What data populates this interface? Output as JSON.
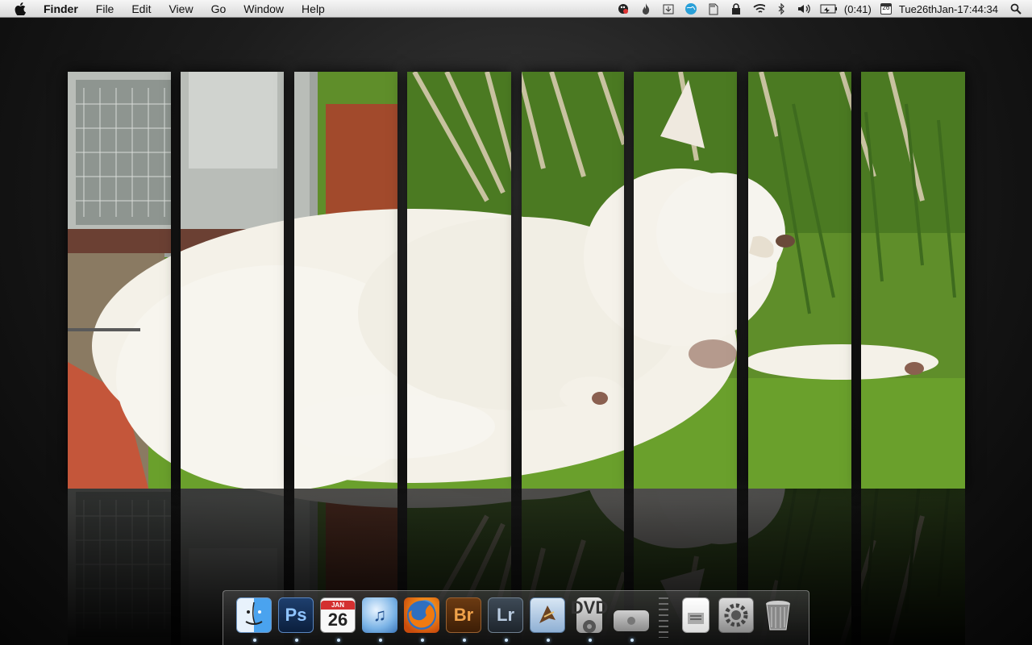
{
  "menubar": {
    "apple_icon": "apple-icon",
    "app_name": "Finder",
    "menus": [
      "File",
      "Edit",
      "View",
      "Go",
      "Window",
      "Help"
    ],
    "status_icons": [
      "growl-icon",
      "flame-icon",
      "download-icon",
      "globe-icon",
      "sd-card-icon",
      "lock-icon",
      "wifi-icon",
      "bluetooth-icon",
      "volume-icon",
      "battery-icon"
    ],
    "battery_text": "(0:41)",
    "calendar_day": "26",
    "clock": "Tue26thJan-17:44:34",
    "spotlight_icon": "spotlight-icon"
  },
  "desktop": {
    "wallpaper": "white dog lying on grass, split into vertical strips with reflection",
    "colors": {
      "grass": "#6a9a2a",
      "fur": "#f4f2ea",
      "background_dark": "#111111",
      "shed_red": "#b84a30"
    }
  },
  "dock": {
    "items": [
      {
        "name": "Finder",
        "icon": "finder-icon",
        "label": "",
        "running": true
      },
      {
        "name": "Photoshop",
        "icon": "photoshop-icon",
        "label": "Ps",
        "running": true
      },
      {
        "name": "iCal",
        "icon": "calendar-icon",
        "label": "26",
        "month": "JAN",
        "running": true
      },
      {
        "name": "iTunes",
        "icon": "itunes-icon",
        "label": "♫",
        "running": true
      },
      {
        "name": "Firefox",
        "icon": "firefox-icon",
        "label": "",
        "running": true
      },
      {
        "name": "Bridge",
        "icon": "bridge-icon",
        "label": "Br",
        "running": true
      },
      {
        "name": "Lightroom",
        "icon": "lightroom-icon",
        "label": "Lr",
        "running": true
      },
      {
        "name": "Mail",
        "icon": "mail-icon",
        "label": "",
        "running": true
      },
      {
        "name": "DVD Player",
        "icon": "dvd-player-icon",
        "label": "DVD",
        "running": true
      },
      {
        "name": "Disk",
        "icon": "disk-icon",
        "label": "",
        "running": true
      },
      {
        "name": "Documents",
        "icon": "documents-icon",
        "label": "",
        "running": false
      },
      {
        "name": "System Preferences",
        "icon": "system-preferences-icon",
        "label": "",
        "running": false
      },
      {
        "name": "Trash",
        "icon": "trash-icon",
        "label": "",
        "running": false
      }
    ]
  }
}
